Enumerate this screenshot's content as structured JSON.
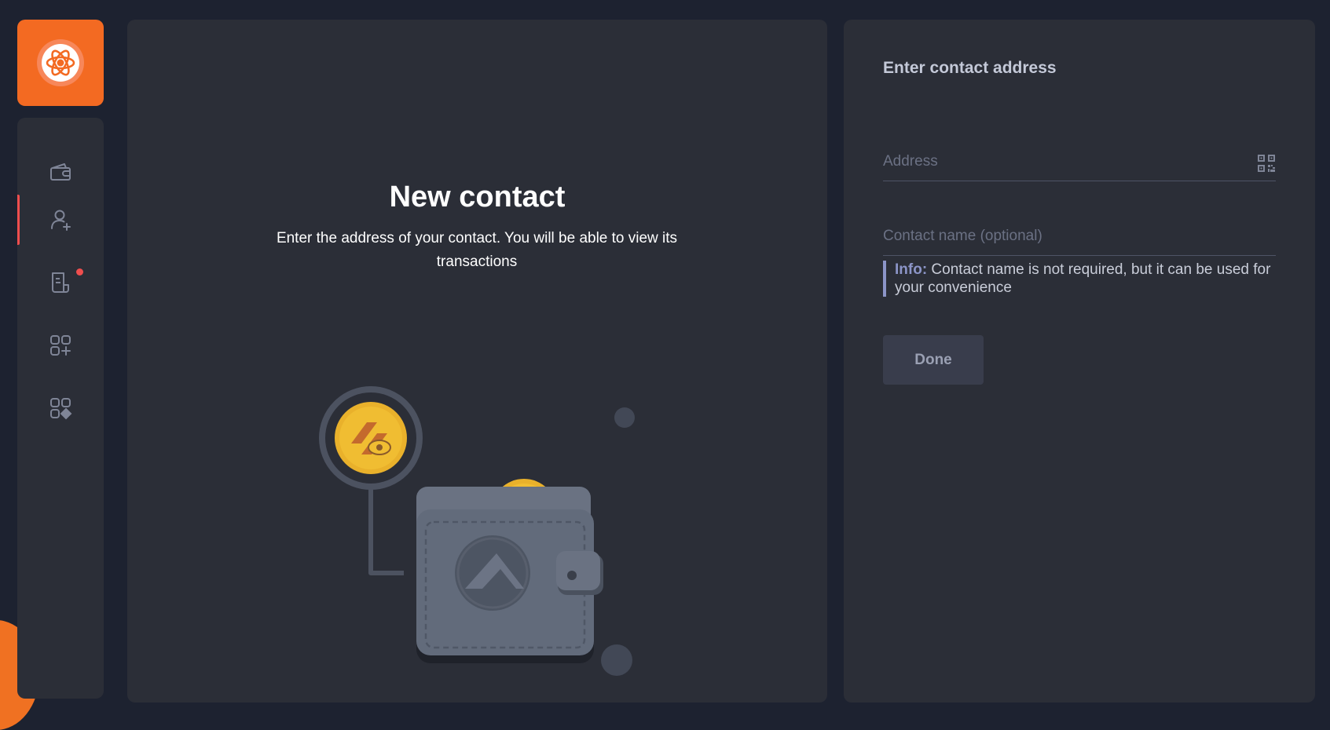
{
  "app": {
    "logo_icon": "atom-flower-logo-icon",
    "accent_color": "#f36a22"
  },
  "sidebar": {
    "items": [
      {
        "name": "wallet",
        "icon": "wallet-icon",
        "active": false,
        "badge": false
      },
      {
        "name": "add-contact",
        "icon": "user-plus-icon",
        "active": true,
        "badge": false
      },
      {
        "name": "transactions",
        "icon": "receipt-icon",
        "active": false,
        "badge": true
      },
      {
        "name": "add-app",
        "icon": "apps-plus-icon",
        "active": false,
        "badge": false
      },
      {
        "name": "dapps",
        "icon": "apps-diamond-icon",
        "active": false,
        "badge": false
      }
    ],
    "badge_color": "#ef4e4e"
  },
  "main": {
    "title": "New contact",
    "subtitle": "Enter the address of your contact. You will be able to view its transactions",
    "illustration": "magnifier-coin-wallet-illustration"
  },
  "form": {
    "heading": "Enter contact address",
    "address_placeholder": "Address",
    "address_value": "",
    "name_placeholder": "Contact name (optional)",
    "name_value": "",
    "qr_icon": "qr-code-icon",
    "info_label": "Info:",
    "info_text": " Contact name is not required, but it can be used for your convenience",
    "done_label": "Done"
  }
}
